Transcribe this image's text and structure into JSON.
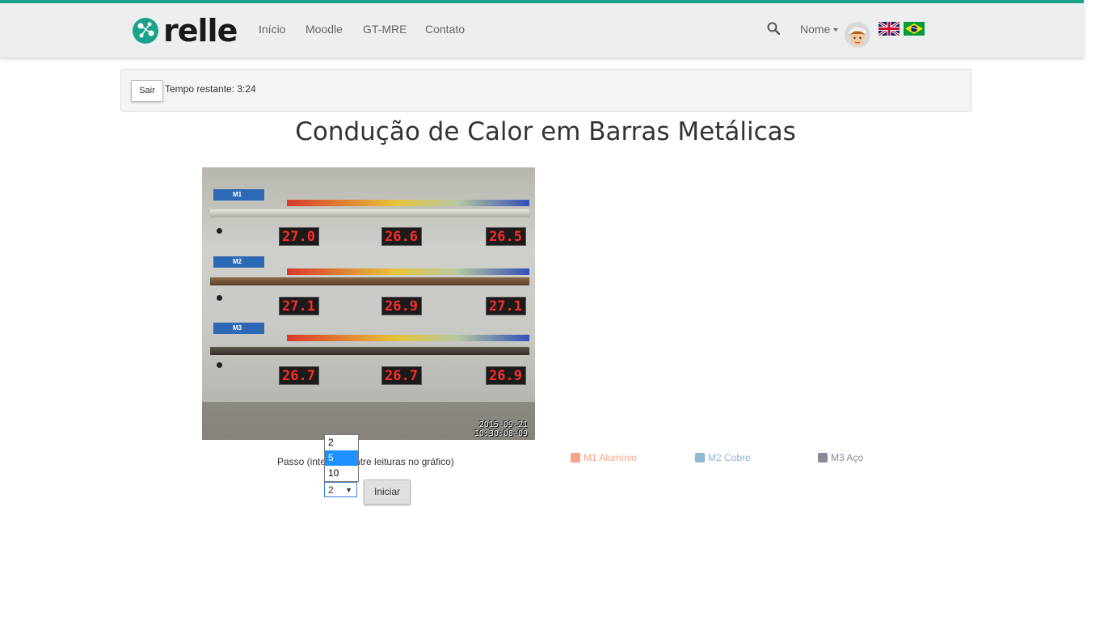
{
  "nav": {
    "logo_text": "relle",
    "items": [
      {
        "label": "Início"
      },
      {
        "label": "Moodle"
      },
      {
        "label": "GT-MRE"
      },
      {
        "label": "Contato"
      }
    ],
    "user_name": "Nome",
    "icons": {
      "search": "search-icon",
      "user": "avatar",
      "flag_en": "uk-flag-icon",
      "flag_pt": "brazil-flag-icon"
    },
    "accent_color": "#1aa38a"
  },
  "session": {
    "exit_label": "Sair",
    "timer_text": "Tempo restante: 3:24"
  },
  "page": {
    "title": "Condução de Calor em Barras Metálicas"
  },
  "camera": {
    "tags": [
      "M1",
      "M2",
      "M3"
    ],
    "readings": [
      [
        "27.0",
        "26.6",
        "26.5"
      ],
      [
        "27.1",
        "26.9",
        "27.1"
      ],
      [
        "26.7",
        "26.7",
        "26.9"
      ]
    ],
    "timestamp_date": "2015-09-21",
    "timestamp_time": "10:30:08-09"
  },
  "controls": {
    "passo_label": "Passo (intervalo entre leituras no gráfico)",
    "dropdown_options": [
      "2",
      "5",
      "10"
    ],
    "highlighted_option": "5",
    "selected_value": "2",
    "start_label": "Iniciar"
  },
  "legend": [
    {
      "label": "M1 Alumínio",
      "color": "#f4a58a"
    },
    {
      "label": "M2 Cobre",
      "color": "#8fb8d4"
    },
    {
      "label": "M3 Aço",
      "color": "#8c8899"
    }
  ]
}
